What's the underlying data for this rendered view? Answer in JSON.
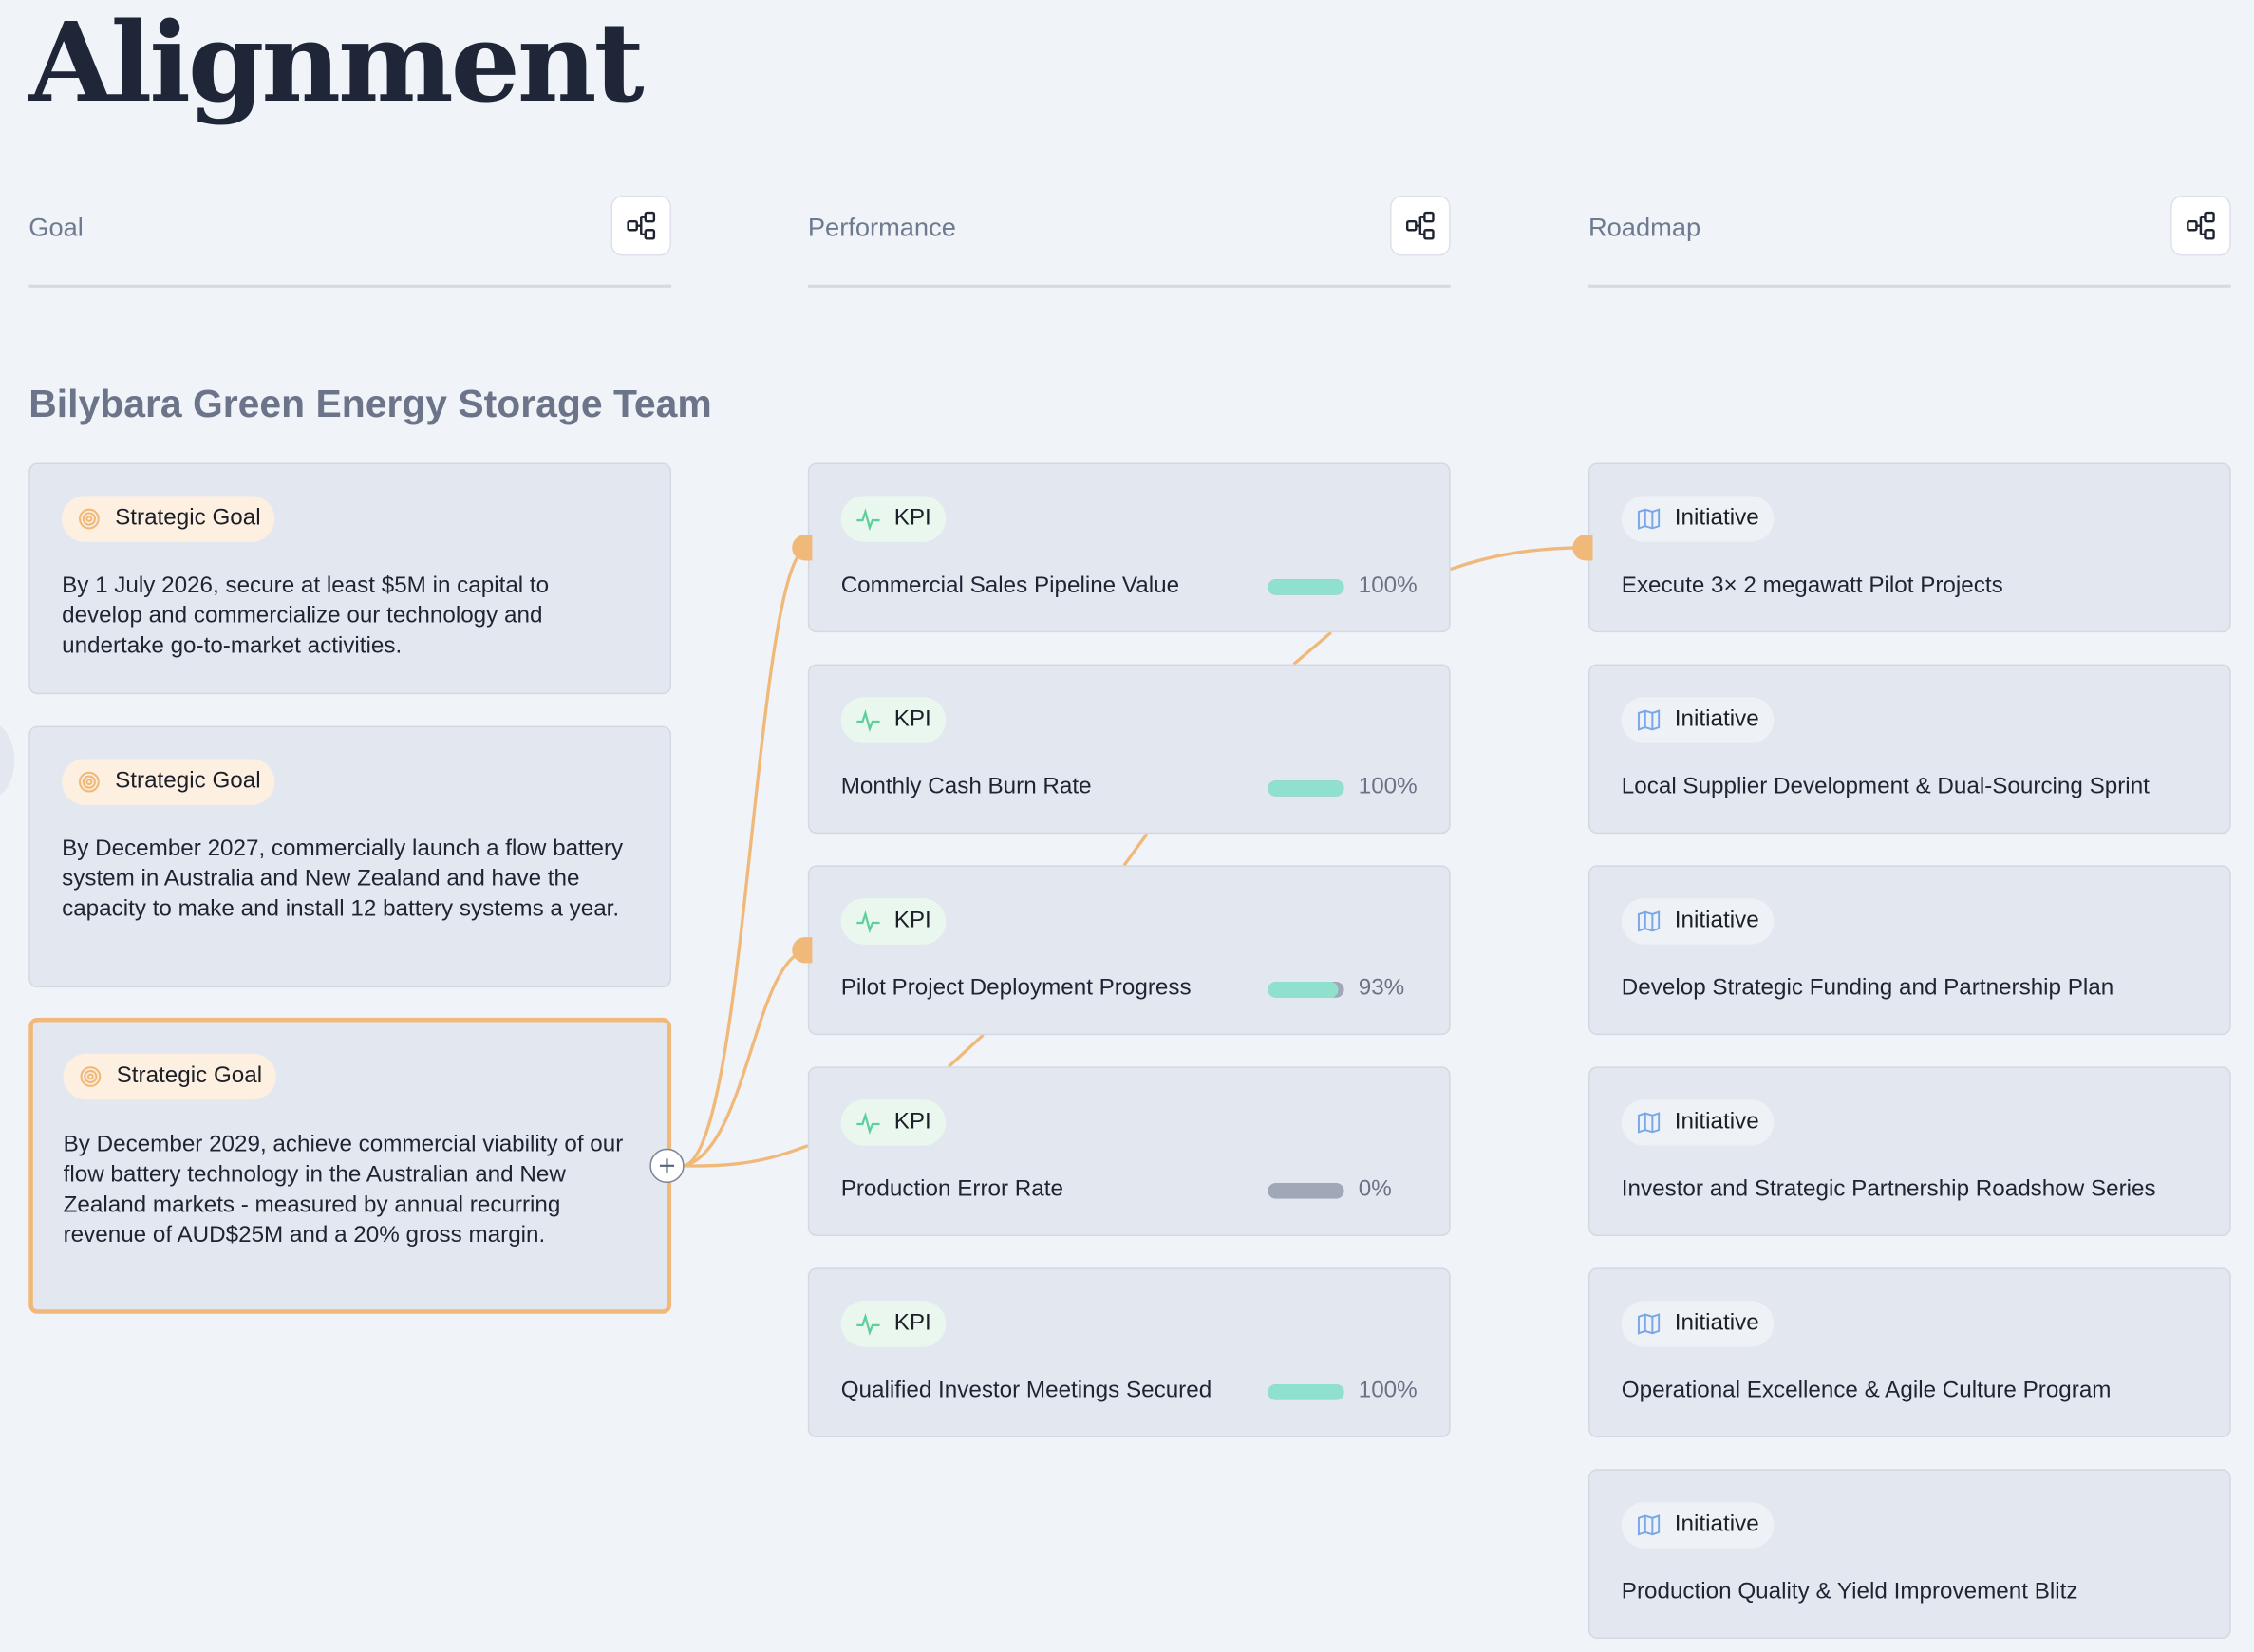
{
  "page": {
    "title": "Alignment"
  },
  "columns": [
    {
      "label": "Goal"
    },
    {
      "label": "Performance"
    },
    {
      "label": "Roadmap"
    }
  ],
  "team": {
    "name": "Bilybara Green Energy Storage Team"
  },
  "goals": [
    {
      "tag": "Strategic Goal",
      "text": "By 1 July 2026, secure at least $5M in capital to develop and commercialize our technology and undertake go-to-market activities."
    },
    {
      "tag": "Strategic Goal",
      "text": "By December 2027, commercially launch a flow battery system in Australia and New Zealand and have the capacity to make and install 12 battery systems a year."
    },
    {
      "tag": "Strategic Goal",
      "text": "By December 2029, achieve commercial viability of our flow battery technology in the Australian and New Zealand markets - measured by annual recurring revenue of AUD$25M and a 20% gross margin."
    }
  ],
  "kpis": [
    {
      "tag": "KPI",
      "title": "Commercial Sales Pipeline Value",
      "progress": 100,
      "pct": "100%"
    },
    {
      "tag": "KPI",
      "title": "Monthly Cash Burn Rate",
      "progress": 100,
      "pct": "100%"
    },
    {
      "tag": "KPI",
      "title": "Pilot Project Deployment Progress",
      "progress": 93,
      "pct": "93%"
    },
    {
      "tag": "KPI",
      "title": "Production Error Rate",
      "progress": 0,
      "pct": "0%"
    },
    {
      "tag": "KPI",
      "title": "Qualified Investor Meetings Secured",
      "progress": 100,
      "pct": "100%"
    }
  ],
  "initiatives": [
    {
      "tag": "Initiative",
      "title": "Execute 3× 2 megawatt Pilot Projects"
    },
    {
      "tag": "Initiative",
      "title": "Local Supplier Development & Dual-Sourcing Sprint"
    },
    {
      "tag": "Initiative",
      "title": "Develop Strategic Funding and Partnership Plan"
    },
    {
      "tag": "Initiative",
      "title": "Investor and Strategic Partnership Roadshow Series"
    },
    {
      "tag": "Initiative",
      "title": "Operational Excellence & Agile Culture Program"
    },
    {
      "tag": "Initiative",
      "title": "Production Quality & Yield Improvement Blitz"
    }
  ],
  "icons": {
    "goal": "target-icon",
    "kpi": "pulse-icon",
    "initiative": "map-icon",
    "hierarchy": "hierarchy-icon",
    "add": "plus-icon"
  },
  "colors": {
    "accent": "#f1b979",
    "progress_fill": "#8fe0cc",
    "progress_empty": "#a0a8b8",
    "kpi_icon": "#5ccf9a",
    "initiative_icon": "#7aa7e8"
  }
}
